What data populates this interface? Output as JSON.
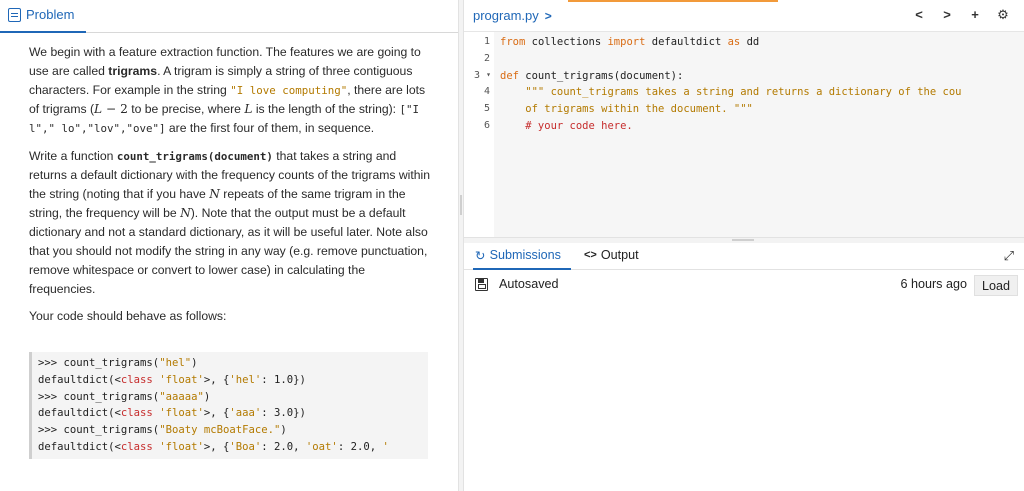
{
  "left": {
    "tab_label": "Problem",
    "para1": {
      "t1": "We begin with a feature extraction function. The features we are going to use are called ",
      "b1": "trigrams",
      "t2": ". A trigram is simply a string of three contiguous characters. For example in the string ",
      "code1": "\"I love computing\"",
      "t3": ", there are lots of trigrams (",
      "m1": "L",
      "m2": " − 2",
      "t4": " to be precise, where ",
      "m3": "L",
      "t5": " is the length of the string): ",
      "code2": "[\"I l\",\" lo\",\"lov\",\"ove\"]",
      "t6": " are the first four of them, in sequence."
    },
    "para2": {
      "t1": "Write a function ",
      "code1": "count_trigrams(document)",
      "t2": " that takes a string and returns a default dictionary with the frequency counts of the trigrams within the string (noting that if you have ",
      "m1": "N",
      "t3": " repeats of the same trigram in the string, the frequency will be ",
      "m2": "N",
      "t4": "). Note that the output must be a default dictionary and not a standard dictionary, as it will be useful later. Note also that you should not modify the string in any way (e.g. remove punctuation, remove whitespace or convert to lower case) in calculating the frequencies."
    },
    "para3": "Your code should behave as follows:",
    "example": {
      "l1a": ">>> count_trigrams(",
      "l1b": "\"hel\"",
      "l1c": ")",
      "l2a": "defaultdict(<",
      "l2b": "class",
      "l2c": " ",
      "l2d": "'float'",
      "l2e": ">, {",
      "l2f": "'hel'",
      "l2g": ": 1.0})",
      "l3a": ">>> count_trigrams(",
      "l3b": "\"aaaaa\"",
      "l3c": ")",
      "l4a": "defaultdict(<",
      "l4b": "class",
      "l4c": " ",
      "l4d": "'float'",
      "l4e": ">, {",
      "l4f": "'aaa'",
      "l4g": ": 3.0})",
      "l5a": ">>> count_trigrams(",
      "l5b": "\"Boaty mcBoatFace.\"",
      "l5c": ")",
      "l6a": "defaultdict(<",
      "l6b": "class",
      "l6c": " ",
      "l6d": "'float'",
      "l6e": ">, {",
      "l6f": "'Boa'",
      "l6g": ": 2.0, ",
      "l6h": "'oat'",
      "l6i": ": 2.0, ",
      "l6j": "'"
    }
  },
  "editor": {
    "file_name": "program.py",
    "chevron": ">",
    "tools": [
      "<",
      ">",
      "+",
      "⚙"
    ],
    "line_numbers": [
      "1",
      "2",
      "3",
      "4",
      "5",
      "6"
    ],
    "fold_marker": "▾",
    "lines": {
      "l1a": "from",
      "l1b": " collections ",
      "l1c": "import",
      "l1d": " defaultdict ",
      "l1e": "as",
      "l1f": " dd",
      "l3a": "def",
      "l3b": " count_trigrams(document):",
      "l4": "    \"\"\" count_trigrams takes a string and returns a dictionary of the cou",
      "l5": "    of trigrams within the document. \"\"\"",
      "l6": "    # your code here."
    }
  },
  "output": {
    "tab_submissions": "Submissions",
    "tab_output": "Output",
    "submissions_icon": "↻",
    "output_icon": "<>",
    "expand_icon": "⤢",
    "autosaved": "Autosaved",
    "time": "6 hours ago",
    "load": "Load"
  }
}
